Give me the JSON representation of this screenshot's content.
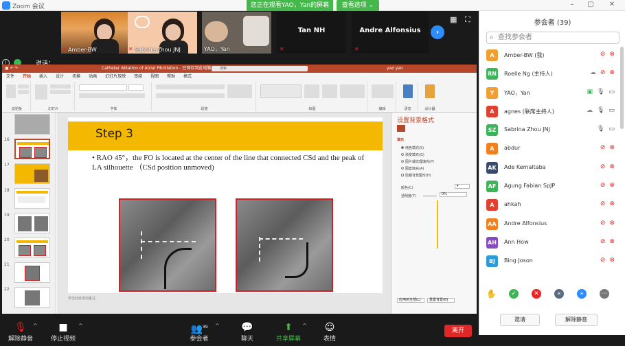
{
  "app": {
    "title": "Zoom 会议"
  },
  "share_banner": {
    "text": "您正在观看YAO，Yan的屏幕",
    "view_options": "查看选项 ⌄"
  },
  "thumbnails": [
    {
      "name": "Amber-BW"
    },
    {
      "name": "Sabrina Zhou JNJ"
    },
    {
      "name": "YAO，Yan"
    },
    {
      "name": "Tan NH"
    },
    {
      "name": "Andre Alfonsius"
    }
  ],
  "speaker": {
    "label": "说话："
  },
  "ppt": {
    "app_title": "Catheter Ablation of Atrial Fibrillation - 已保存到此电脑",
    "search_placeholder": "搜索",
    "user": "yao yan",
    "tabs": [
      "文件",
      "开始",
      "插入",
      "设计",
      "切换",
      "动画",
      "幻灯片放映",
      "审阅",
      "视图",
      "帮助",
      "格式"
    ],
    "active_tab": "开始",
    "ribbon_groups": [
      "剪贴板",
      "幻灯片",
      "字体",
      "段落",
      "绘图",
      "编辑",
      "语音",
      "设计器"
    ],
    "slide_numbers": [
      "16",
      "17",
      "18",
      "19",
      "20",
      "21",
      "22"
    ],
    "slide": {
      "heading": "Step 3",
      "bullet": "• RAO 45°，the FO is located at the center of the line that connected CSd and the peak of LA silhouette （CSd position unmoved)"
    },
    "format_pane": {
      "title": "设置背景格式",
      "section": "填充",
      "options": [
        "纯色填充(S)",
        "渐变填充(G)",
        "图片或纹理填充(P)",
        "图案填充(A)",
        "隐藏背景图形(H)"
      ],
      "color_label": "颜色(C)",
      "transparency_label": "透明度(T)",
      "transparency_value": "0%",
      "apply_all": "应用到全部(L)",
      "reset": "重置背景(B)"
    },
    "notes_hint": "单击此处添加备注"
  },
  "bottom_bar": {
    "unmute": "解除静音",
    "stop_video": "停止视频",
    "participants": "参会者",
    "participant_count": "39",
    "chat": "聊天",
    "share_screen": "共享屏幕",
    "reactions": "表情",
    "end": "离开"
  },
  "panel": {
    "title": "参会者 (39)",
    "search_placeholder": "查找参会者",
    "participants": [
      {
        "initials": "A",
        "name": "Amber-BW (我)",
        "color": "#f0a030",
        "cloud": false,
        "mic_on": false,
        "cam_on": false
      },
      {
        "initials": "RN",
        "name": "Roelle Ng (主持人)",
        "color": "#3cb45a",
        "cloud": true,
        "mic_on": false,
        "cam_on": false
      },
      {
        "initials": "Y",
        "name": "YAO，Yan",
        "color": "#f0a030",
        "cloud": false,
        "sharing": true,
        "mic_on": true,
        "cam_on": true
      },
      {
        "initials": "A",
        "name": "agnes (联席主持人)",
        "color": "#e04030",
        "cloud": true,
        "mic_on": true,
        "cam_on": true
      },
      {
        "initials": "SZ",
        "name": "Sabrina Zhou JNJ",
        "color": "#3cb45a",
        "cloud": false,
        "mic_on": true,
        "cam_on": true
      },
      {
        "initials": "A",
        "name": "abdur",
        "color": "#f08020",
        "cloud": false,
        "mic_on": false,
        "cam_on": false
      },
      {
        "initials": "AK",
        "name": "Ade Kemaltaba",
        "color": "#3c4a6a",
        "cloud": false,
        "mic_on": false,
        "cam_on": false
      },
      {
        "initials": "AF",
        "name": "Agung Fabian SpJP",
        "color": "#3cb45a",
        "cloud": false,
        "mic_on": false,
        "cam_on": false
      },
      {
        "initials": "A",
        "name": "ahkah",
        "color": "#e04030",
        "cloud": false,
        "mic_on": false,
        "cam_on": false
      },
      {
        "initials": "AA",
        "name": "Andre Alfonsius",
        "color": "#f08020",
        "cloud": false,
        "mic_on": false,
        "cam_on": false
      },
      {
        "initials": "AH",
        "name": "Ann How",
        "color": "#8a4abf",
        "cloud": false,
        "mic_on": false,
        "cam_on": false
      },
      {
        "initials": "BJ",
        "name": "Bing Joson",
        "color": "#2a9ad8",
        "cloud": false,
        "mic_on": false,
        "cam_on": false
      }
    ],
    "invite": "邀请",
    "unmute_me": "解除静音"
  }
}
